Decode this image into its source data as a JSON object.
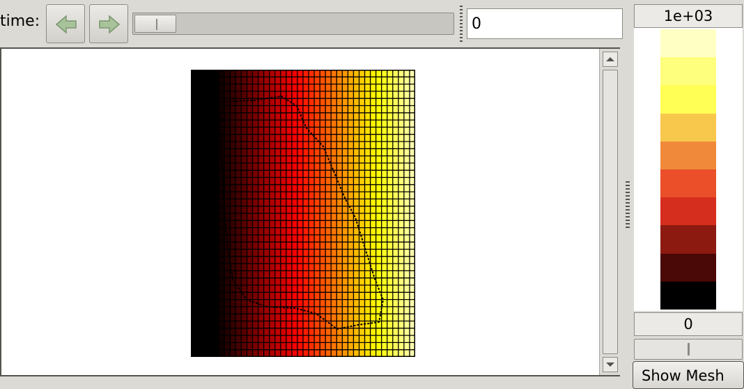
{
  "toolbar": {
    "time_label": "time:",
    "time_value": "0",
    "slider_position": 0,
    "back_icon": "left-arrow-icon",
    "forward_icon": "right-arrow-icon"
  },
  "colorbar": {
    "max_label": "1e+03",
    "min_label": "0",
    "button_label": "Show Mesh",
    "colors": [
      "#ffffc4",
      "#ffff7e",
      "#ffff55",
      "#f8c84c",
      "#f08a3a",
      "#ea4f2a",
      "#d52e1e",
      "#8c1a10",
      "#4a0806",
      "#000000"
    ]
  },
  "plot": {
    "colormap": "hot",
    "mesh_cols": 40,
    "mesh_rows": 40
  }
}
